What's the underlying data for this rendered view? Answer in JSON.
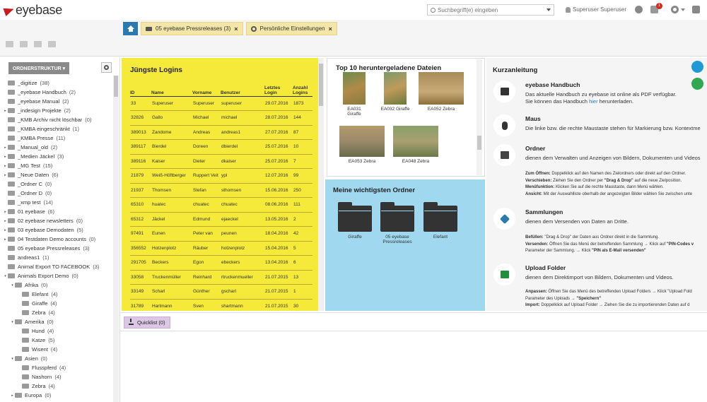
{
  "header": {
    "logo_text": "eyebase",
    "search_placeholder": "Suchbegriff(e) eingeben",
    "user": "Superuser Superuser",
    "notification_count": "1",
    "brand_color": "#c81e1e"
  },
  "tabs": [
    {
      "label": "05 eyebase Pressreleases (3)",
      "icon": "folder-icon",
      "close": "×"
    },
    {
      "label": "Persönliche Einstellungen",
      "icon": "gear-icon",
      "close": "×"
    }
  ],
  "sidebar": {
    "button_label": "ORDNERSTRUKTUR ▾",
    "items": [
      {
        "label": "_digitize",
        "count": "(38)",
        "level": 0,
        "arrow": ""
      },
      {
        "label": "_eyebase Handbuch",
        "count": "(2)",
        "level": 0,
        "arrow": ""
      },
      {
        "label": "_eyebase Manual",
        "count": "(2)",
        "level": 0,
        "arrow": ""
      },
      {
        "label": "_indesign Projekte",
        "count": "(2)",
        "level": 0,
        "arrow": "▸"
      },
      {
        "label": "_KMB Archiv nicht löschbar",
        "count": "(0)",
        "level": 0,
        "arrow": ""
      },
      {
        "label": "_KMBA eingeschränkt",
        "count": "(1)",
        "level": 0,
        "arrow": ""
      },
      {
        "label": "_KMBA Presse",
        "count": "(11)",
        "level": 0,
        "arrow": ""
      },
      {
        "label": "_Manual_old",
        "count": "(2)",
        "level": 0,
        "arrow": "▸"
      },
      {
        "label": "_Medien Jäckel",
        "count": "(3)",
        "level": 0,
        "arrow": "▸"
      },
      {
        "label": "_MG Test",
        "count": "(15)",
        "level": 0,
        "arrow": "▸"
      },
      {
        "label": "_Neue Daten",
        "count": "(6)",
        "level": 0,
        "arrow": "▸"
      },
      {
        "label": "_Ordner C",
        "count": "(0)",
        "level": 0,
        "arrow": ""
      },
      {
        "label": "_Ordner D",
        "count": "(0)",
        "level": 0,
        "arrow": ""
      },
      {
        "label": "_xmp test",
        "count": "(14)",
        "level": 0,
        "arrow": ""
      },
      {
        "label": "01 eyebase",
        "count": "(6)",
        "level": 0,
        "arrow": "▸"
      },
      {
        "label": "02 eyebase newsletters",
        "count": "(0)",
        "level": 0,
        "arrow": "▸"
      },
      {
        "label": "03 eyebase Demodaten",
        "count": "(5)",
        "level": 0,
        "arrow": "▸"
      },
      {
        "label": "04 Testdaten Demo accounts",
        "count": "(0)",
        "level": 0,
        "arrow": "▸"
      },
      {
        "label": "05 eyebase Pressreleases",
        "count": "(3)",
        "level": 0,
        "arrow": ""
      },
      {
        "label": "andreas1",
        "count": "(1)",
        "level": 0,
        "arrow": ""
      },
      {
        "label": "Animal Export TO FACEBOOK",
        "count": "(3)",
        "level": 0,
        "arrow": ""
      },
      {
        "label": "Animals Export Demo",
        "count": "(0)",
        "level": 0,
        "arrow": "▾"
      },
      {
        "label": "Afrika",
        "count": "(0)",
        "level": 1,
        "arrow": "▾"
      },
      {
        "label": "Elefant",
        "count": "(4)",
        "level": 2,
        "arrow": ""
      },
      {
        "label": "Giraffe",
        "count": "(4)",
        "level": 2,
        "arrow": ""
      },
      {
        "label": "Zebra",
        "count": "(4)",
        "level": 2,
        "arrow": ""
      },
      {
        "label": "Amerika",
        "count": "(0)",
        "level": 1,
        "arrow": "▾"
      },
      {
        "label": "Hund",
        "count": "(4)",
        "level": 2,
        "arrow": ""
      },
      {
        "label": "Katze",
        "count": "(5)",
        "level": 2,
        "arrow": ""
      },
      {
        "label": "Wisent",
        "count": "(4)",
        "level": 2,
        "arrow": ""
      },
      {
        "label": "Asien",
        "count": "(0)",
        "level": 1,
        "arrow": "▾"
      },
      {
        "label": "Flusspferd",
        "count": "(4)",
        "level": 2,
        "arrow": ""
      },
      {
        "label": "Nashorn",
        "count": "(4)",
        "level": 2,
        "arrow": ""
      },
      {
        "label": "Zebra",
        "count": "(4)",
        "level": 2,
        "arrow": ""
      },
      {
        "label": "Europa",
        "count": "(0)",
        "level": 1,
        "arrow": "▸"
      }
    ]
  },
  "logins": {
    "title": "Jüngste Logins",
    "headers": [
      "ID",
      "Name",
      "Vorname",
      "Benutzer",
      "Letztes Login",
      "Anzahl Logins"
    ],
    "rows": [
      [
        "33",
        "Superuser",
        "Superuser",
        "superuser",
        "29.07.2016",
        "1873"
      ],
      [
        "32826",
        "Gallo",
        "Michael",
        "michael",
        "28.07.2016",
        "144"
      ],
      [
        "389013",
        "Zandome",
        "Andreas",
        "andreas1",
        "27.07.2016",
        "87"
      ],
      [
        "389117",
        "Bierdel",
        "Doreen",
        "dbierdel",
        "25.07.2016",
        "10"
      ],
      [
        "389116",
        "Kaiser",
        "Dieter",
        "dkaiser",
        "25.07.2016",
        "7"
      ],
      [
        "21879",
        "Weiß-Höftberger",
        "Ruppert Veit",
        "ypl",
        "12.07.2016",
        "99"
      ],
      [
        "21937",
        "Thomsen",
        "Stefan",
        "sthomsen",
        "15.06.2016",
        "250"
      ],
      [
        "65310",
        "huatec",
        "chuatec",
        "chuatec",
        "08.06.2016",
        "111"
      ],
      [
        "65312",
        "Jäckel",
        "Edmund",
        "ejaeckel",
        "13.05.2016",
        "2"
      ],
      [
        "97491",
        "Eunen",
        "Peter van",
        "peunen",
        "18.04.2016",
        "42"
      ],
      [
        "356552",
        "Hotzenplotz",
        "Räuber",
        "hotzenplotz",
        "15.04.2016",
        "5"
      ],
      [
        "291705",
        "Beckers",
        "Egon",
        "ebeckers",
        "13.04.2016",
        "6"
      ],
      [
        "33058",
        "Truckenmüller",
        "Reinhard",
        "rtruckenmueller",
        "21.07.2015",
        "13"
      ],
      [
        "33149",
        "Scharl",
        "Günther",
        "gscharl",
        "21.07.2015",
        "1"
      ],
      [
        "31789",
        "Hartmann",
        "Sven",
        "shartmann",
        "21.07.2015",
        "30"
      ],
      [
        "2492",
        "Dechmann",
        "Frank",
        "frank",
        "20.07.2015",
        "133"
      ]
    ]
  },
  "top10": {
    "title": "Top 10 heruntergeladene Dateien",
    "files": [
      "EA031 Giraffe",
      "EA032 Giraffe",
      "EA052 Zebra",
      "EA053 Zebra",
      "EA048 Zebra"
    ]
  },
  "folders": {
    "title": "Meine wichtigsten Ordner",
    "items": [
      "Giraffe",
      "05 eyebase Pressreleases",
      "Elefant"
    ]
  },
  "guide": {
    "title": "Kurzanleitung",
    "handbuch": {
      "title": "eyebase Handbuch",
      "line1": "Das aktuelle Handbuch zu eyebase ist online als PDF verfügbar.",
      "line2_pre": "Sie können das Handbuch ",
      "line2_link": "hier",
      "line2_post": " herunterladen."
    },
    "maus": {
      "title": "Maus",
      "line1": "Die linke bzw. die rechte Maustaste stehen für Markierung bzw. Kontextme"
    },
    "ordner": {
      "title": "Ordner",
      "line1": "dienen dem Verwalten und Anzeigen von Bildern, Dokumenten und Videos",
      "d1_b": "Zum Öffnen:",
      "d1": " Doppelklick auf den Namen des Zielordners oder direkt auf den Ordner.",
      "d2_b": "Verschieben:",
      "d2": " Ziehen Sie den Ordner per ",
      "d2_b2": "\"Drag & Drop\"",
      "d2_post": " auf die neue Zielposition.",
      "d3_b": "Menüfunktion:",
      "d3": " Klicken Sie auf die rechte Maustaste, dann Menü wählen.",
      "d4_b": "Ansicht:",
      "d4": " Mit der Auswahlliste oberhalb der angezeigten Bilder wählen Sie zwischen unte"
    },
    "sammlungen": {
      "title": "Sammlungen",
      "line1": "dienen dem Versenden von Daten an Dritte.",
      "d1_b": "Befüllen:",
      "d1": " \"Drag & Drop\" der Daten aus Ordner direkt in die Sammlung.",
      "d2_b": "Versenden:",
      "d2": " Öffnen Sie das Menü der betreffenden Sammlung → Klick auf ",
      "d2_b2": "\"PIN-Codes v",
      "d3": "Parameter der Sammlung. → Klick ",
      "d3_b": "\"PIN als E-Mail versenden\""
    },
    "upload": {
      "title": "Upload Folder",
      "line1": "dienen dem Direktimport von Bildern, Dokumenten und Videos.",
      "d1_b": "Anpassen:",
      "d1": " Öffnen Sie das Menü des betreffenden Upload Folders → Klick \"Upload Fold",
      "d2": "Parameter des Uploads → ",
      "d2_b": "\"Speichern\"",
      "d3_b": "Import:",
      "d3": " Doppelklick auf Upload Folder → Ziehen Sie die zu importierenden Daten auf d"
    }
  },
  "quicklist": {
    "label": "Quicklist (0)"
  },
  "colors": {
    "logins_bg": "#f5e93a",
    "folders_bg": "#9fd8ef",
    "home_tab": "#2a7ab0",
    "tab_bg": "#f3e6a6",
    "fab_blue": "#1e9bd7",
    "fab_green": "#2fa84f"
  }
}
